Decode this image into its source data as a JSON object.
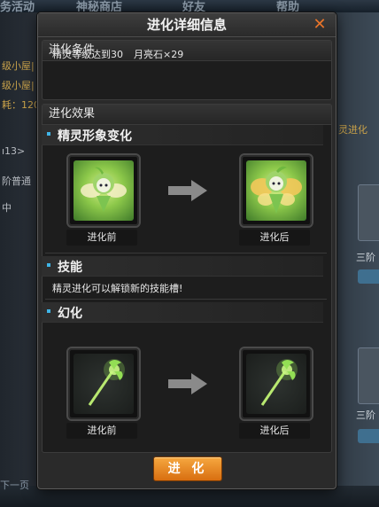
{
  "background": {
    "tabs": [
      "务活动",
      "神秘商店",
      "好友",
      "帮助"
    ],
    "left_texts": [
      "级小屋|",
      "级小屋|",
      "耗：120",
      "ı13>",
      "阶普通",
      "中"
    ],
    "right_tag": "灵进化",
    "right_texts": [
      "三阶",
      "三阶"
    ],
    "bottom_text": "下一页"
  },
  "dialog": {
    "title": "进化详细信息",
    "close_symbol": "✕",
    "conditions": {
      "header": "进化条件",
      "level_req": "精灵等级达到30",
      "item_req": "月亮石×29"
    },
    "effects": {
      "header": "进化效果",
      "appearance": {
        "label": "精灵形象变化",
        "before": "进化前",
        "after": "进化后"
      },
      "skill": {
        "label": "技能",
        "text": "精灵进化可以解锁新的技能槽!"
      },
      "transform": {
        "label": "幻化",
        "before": "进化前",
        "after": "进化后"
      }
    },
    "evolve_button": "进 化"
  },
  "colors": {
    "accent_orange": "#e8742a",
    "bullet_blue": "#3fb4e6",
    "button_orange": "#f09a30"
  }
}
